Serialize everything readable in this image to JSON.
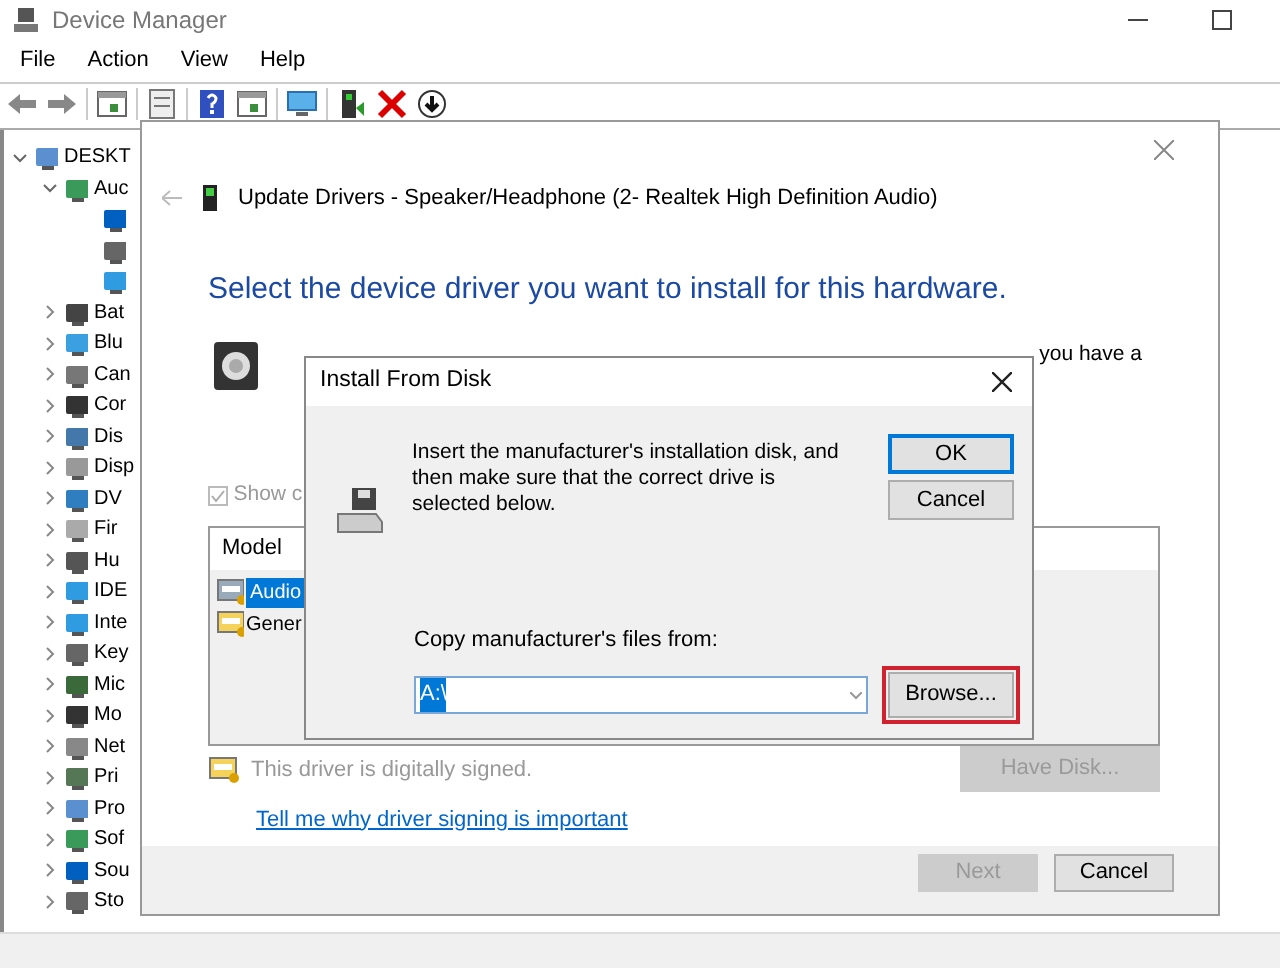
{
  "window": {
    "title": "Device Manager"
  },
  "menu": [
    "File",
    "Action",
    "View",
    "Help"
  ],
  "toolbar": [
    {
      "kind": "back"
    },
    {
      "kind": "forward"
    },
    {
      "kind": "sep"
    },
    {
      "kind": "panel"
    },
    {
      "kind": "sep"
    },
    {
      "kind": "sheet"
    },
    {
      "kind": "sep"
    },
    {
      "kind": "help"
    },
    {
      "kind": "panel"
    },
    {
      "kind": "sep"
    },
    {
      "kind": "monitor"
    },
    {
      "kind": "sep"
    },
    {
      "kind": "update"
    },
    {
      "kind": "remove"
    },
    {
      "kind": "download"
    }
  ],
  "tree": [
    {
      "kind": "category",
      "label": "DESKT",
      "expanded": true,
      "children": [
        {
          "kind": "category",
          "label": "Auc",
          "expanded": true,
          "children": [
            {
              "kind": "device"
            },
            {
              "kind": "device"
            },
            {
              "kind": "device"
            }
          ]
        },
        {
          "kind": "category",
          "label": "Bat",
          "expanded": false
        },
        {
          "kind": "category",
          "label": "Blu",
          "expanded": false
        },
        {
          "kind": "category",
          "label": "Can",
          "expanded": false
        },
        {
          "kind": "category",
          "label": "Cor",
          "expanded": false
        },
        {
          "kind": "category",
          "label": "Dis",
          "expanded": false
        },
        {
          "kind": "category",
          "label": "Disp",
          "expanded": false
        },
        {
          "kind": "category",
          "label": "DV",
          "expanded": false
        },
        {
          "kind": "category",
          "label": "Fir",
          "expanded": false
        },
        {
          "kind": "category",
          "label": "Hu",
          "expanded": false
        },
        {
          "kind": "category",
          "label": "IDE",
          "expanded": false
        },
        {
          "kind": "category",
          "label": "Inte",
          "expanded": false
        },
        {
          "kind": "category",
          "label": "Key",
          "expanded": false
        },
        {
          "kind": "category",
          "label": "Mic",
          "expanded": false
        },
        {
          "kind": "category",
          "label": "Mo",
          "expanded": false
        },
        {
          "kind": "category",
          "label": "Net",
          "expanded": false
        },
        {
          "kind": "category",
          "label": "Pri",
          "expanded": false
        },
        {
          "kind": "category",
          "label": "Pro",
          "expanded": false
        },
        {
          "kind": "category",
          "label": "Sof",
          "expanded": false
        },
        {
          "kind": "category",
          "label": "Sou",
          "expanded": false
        },
        {
          "kind": "category",
          "label": "Sto",
          "expanded": false
        }
      ]
    }
  ],
  "update_dialog": {
    "title": "Update Drivers - Speaker/Headphone (2- Realtek High Definition Audio)",
    "heading": "Select the device driver you want to install for this hardware.",
    "instruction_tail": "you have a",
    "show_compatible": {
      "label": "Show c",
      "checked": true,
      "disabled": true
    },
    "model_list": {
      "column": "Model",
      "rows": [
        {
          "label": "Audio",
          "selected": true
        },
        {
          "label": "Gener",
          "selected": false
        }
      ]
    },
    "signed_text": "This driver is digitally signed.",
    "link": "Tell me why driver signing is important",
    "have_disk": {
      "label": "Have Disk...",
      "disabled": true
    },
    "buttons": [
      {
        "label": "Next",
        "disabled": true
      },
      {
        "label": "Cancel",
        "disabled": false
      }
    ]
  },
  "install_dialog": {
    "title": "Install From Disk",
    "message": "Insert the manufacturer's installation disk, and then make sure that the correct drive is selected below.",
    "ok": {
      "label": "OK",
      "focused": true
    },
    "cancel": {
      "label": "Cancel",
      "focused": false
    },
    "copy_label": "Copy manufacturer's files from:",
    "path": "A:\\",
    "browse": {
      "label": "Browse...",
      "highlighted": true
    }
  }
}
